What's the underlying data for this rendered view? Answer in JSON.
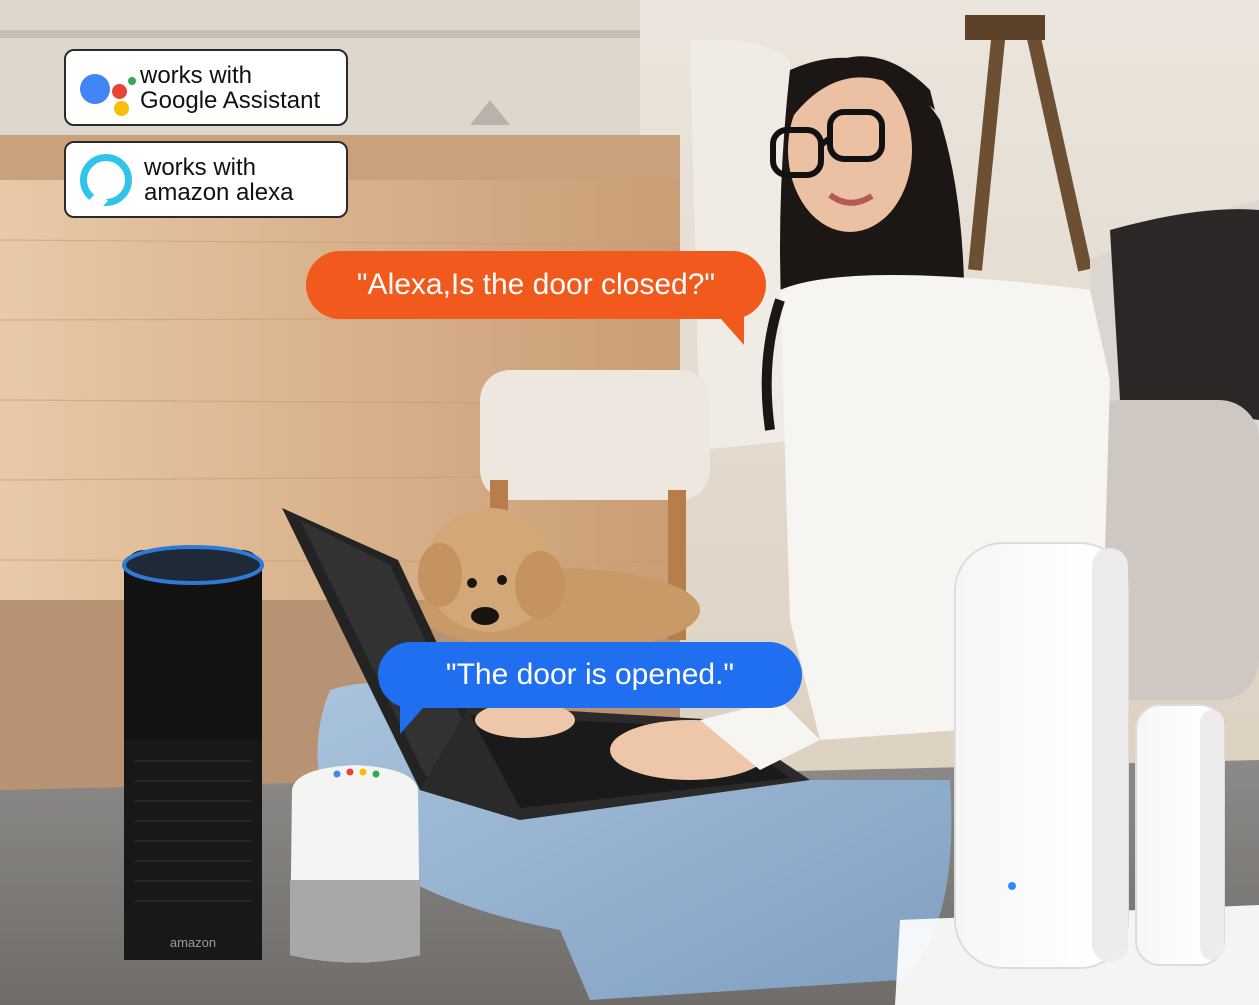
{
  "badges": {
    "google": {
      "line1": "works with",
      "line2": "Google Assistant",
      "colors": [
        "#4285f4",
        "#ea4335",
        "#fbbc05",
        "#34a853"
      ]
    },
    "alexa": {
      "line1": "works with",
      "line2": "amazon alexa",
      "ring_color": "#31c4e8"
    }
  },
  "bubbles": {
    "question": {
      "text": "\"Alexa,Is the door closed?\"",
      "color": "#f25a1d"
    },
    "answer": {
      "text": "\"The door is opened.\"",
      "color": "#1f6ff0"
    }
  },
  "speaker": {
    "brand_text": "amazon"
  }
}
